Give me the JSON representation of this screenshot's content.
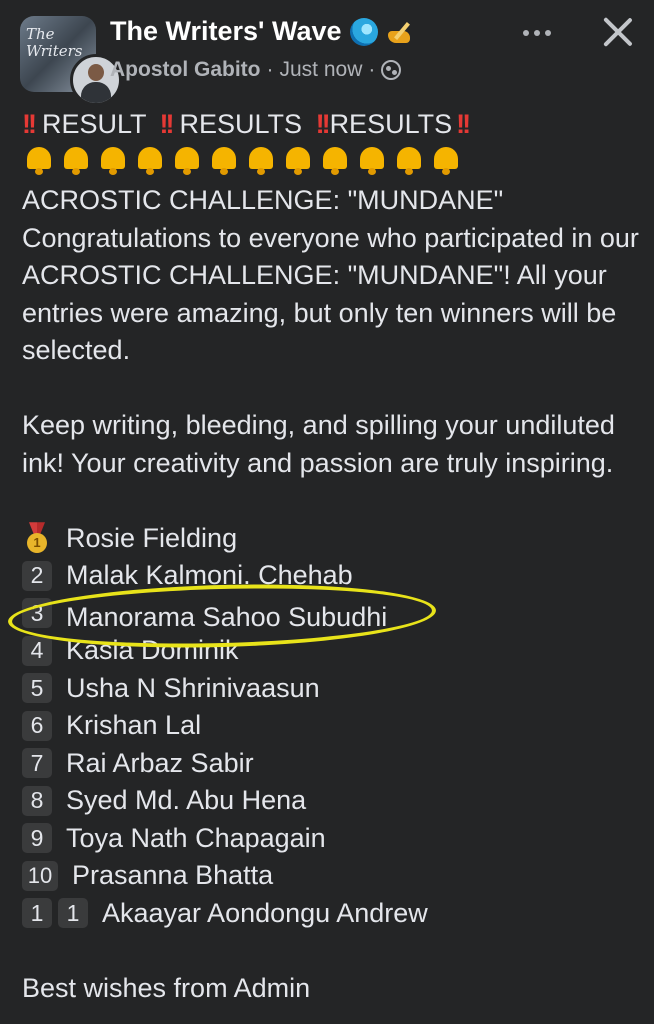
{
  "header": {
    "group_name": "The Writers' Wave",
    "group_name_icons": [
      "wave-icon",
      "pen-icon"
    ],
    "avatar_text": "The Writers",
    "author": "Apostol Gabito",
    "time": "Just now",
    "separator": "·",
    "audience_icon": "globe-icon"
  },
  "post": {
    "title_line": {
      "parts": [
        "RESULT",
        "RESULTS",
        "RESULTS"
      ],
      "icon": "double-exclamation-icon"
    },
    "bell_count": 12,
    "challenge": "ACROSTIC CHALLENGE: \"MUNDANE\"",
    "paragraph1": "Congratulations to everyone who participated in our ACROSTIC CHALLENGE: \"MUNDANE\"! All your entries were amazing, but only ten winners will be selected.",
    "paragraph2": "Keep writing, bleeding, and spilling your undiluted ink! Your creativity and passion are truly inspiring.",
    "winners": [
      {
        "rank": "1",
        "name": "Rosie Fielding",
        "badge": "medal-icon"
      },
      {
        "rank": "2",
        "name": "Malak Kalmoni. Chehab"
      },
      {
        "rank": "3",
        "name": "Manorama Sahoo Subudhi"
      },
      {
        "rank": "4",
        "name": "Kasia Dominik"
      },
      {
        "rank": "5",
        "name": "Usha N Shrinivaasun"
      },
      {
        "rank": "6",
        "name": "Krishan Lal"
      },
      {
        "rank": "7",
        "name": "Rai Arbaz Sabir"
      },
      {
        "rank": "8",
        "name": "Syed Md. Abu Hena"
      },
      {
        "rank": "9",
        "name": "Toya Nath Chapagain"
      },
      {
        "rank": "10",
        "name": "Prasanna Bhatta"
      },
      {
        "rank": "1 1",
        "rank_keys": [
          "1",
          "1"
        ],
        "name": "Akaayar Aondongu Andrew"
      }
    ],
    "closing": "Best wishes from Admin"
  },
  "colors": {
    "background": "#242526",
    "text": "#e4e6eb",
    "secondary_text": "#b0b3b8",
    "highlight": "#e8e31a",
    "alert_red": "#e53935",
    "bell_gold": "#f5b400"
  }
}
